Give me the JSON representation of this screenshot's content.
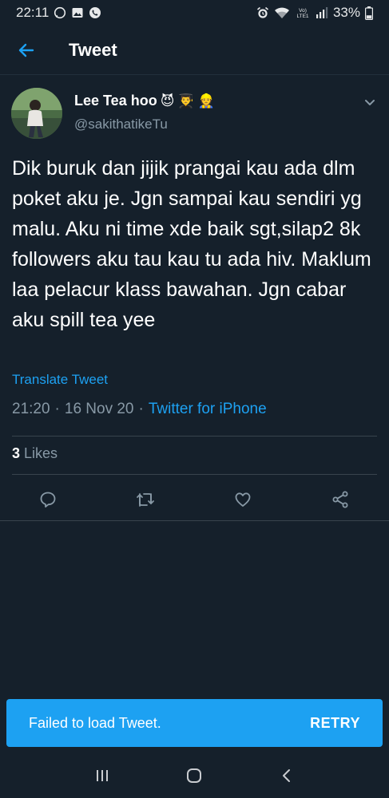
{
  "status_bar": {
    "time": "22:11",
    "left_icons": [
      "whatsapp-icon",
      "gallery-icon",
      "phone-icon"
    ],
    "right_icons": [
      "alarm-icon",
      "wifi-icon",
      "volte-icon",
      "signal-icon"
    ],
    "volte_label": "Vo)\nLTE1",
    "battery_percent": "33%",
    "battery_level": 0.33
  },
  "header": {
    "title": "Tweet"
  },
  "tweet": {
    "author_name": "Lee Tea hoo",
    "author_emojis": [
      "😈",
      "👨‍🎓",
      "👷"
    ],
    "handle": "@sakithatikeTu",
    "text": "Dik buruk dan jijik prangai kau ada dlm poket aku je. Jgn sampai kau sendiri yg malu. Aku ni time xde baik sgt,silap2 8k followers aku tau kau tu ada hiv. Maklum laa pelacur klass bawahan. Jgn cabar aku spill tea yee",
    "translate_label": "Translate Tweet",
    "time": "21:20",
    "date": "16 Nov 20",
    "separator": "·",
    "source": "Twitter for iPhone",
    "likes_count": "3",
    "likes_label": "Likes"
  },
  "actions": [
    "reply-icon",
    "retweet-icon",
    "like-icon",
    "share-icon"
  ],
  "snackbar": {
    "message": "Failed to load Tweet.",
    "action": "RETRY"
  },
  "colors": {
    "background": "#15202b",
    "accent": "#1da1f2",
    "secondary_text": "#8899a6",
    "divider": "#38444d"
  }
}
